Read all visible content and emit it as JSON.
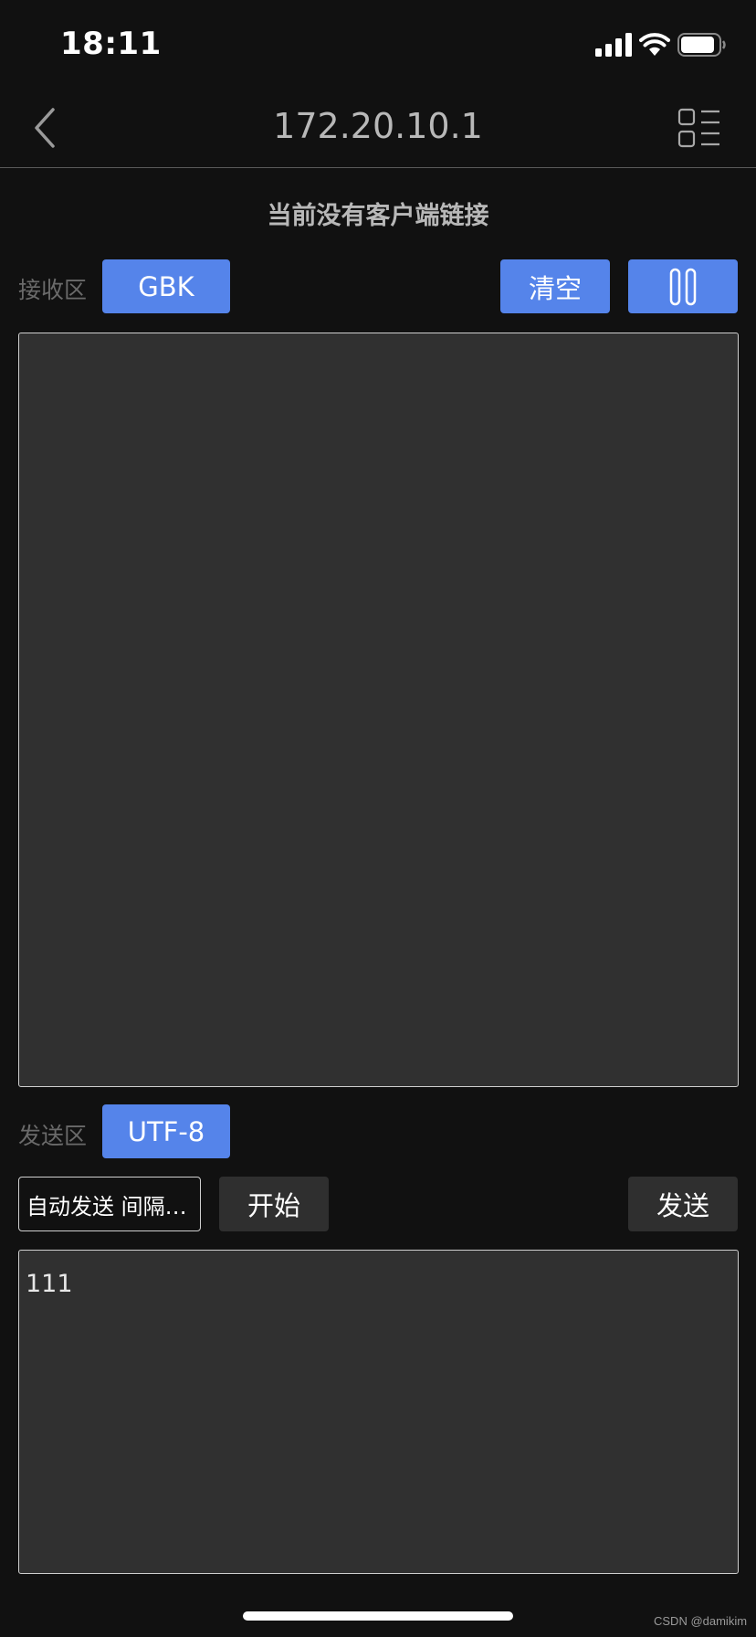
{
  "status_bar": {
    "time": "18:11",
    "icons": [
      "signal-icon",
      "wifi-icon",
      "battery-icon"
    ]
  },
  "nav": {
    "title": "172.20.10.1",
    "back_icon": "chevron-left-icon",
    "menu_icon": "list-menu-icon"
  },
  "connection_status": "当前没有客户端链接",
  "receive": {
    "label": "接收区",
    "encoding": "GBK",
    "clear_label": "清空",
    "pause_icon": "pause-icon",
    "content": ""
  },
  "send": {
    "label": "发送区",
    "encoding": "UTF-8",
    "interval_placeholder": "自动发送 间隔…",
    "start_label": "开始",
    "send_label": "发送",
    "content": "111"
  },
  "watermark": "CSDN @damikim",
  "colors": {
    "background": "#111111",
    "accent": "#5584ea",
    "panel": "#303030",
    "dark_button": "#2f2f2f"
  }
}
